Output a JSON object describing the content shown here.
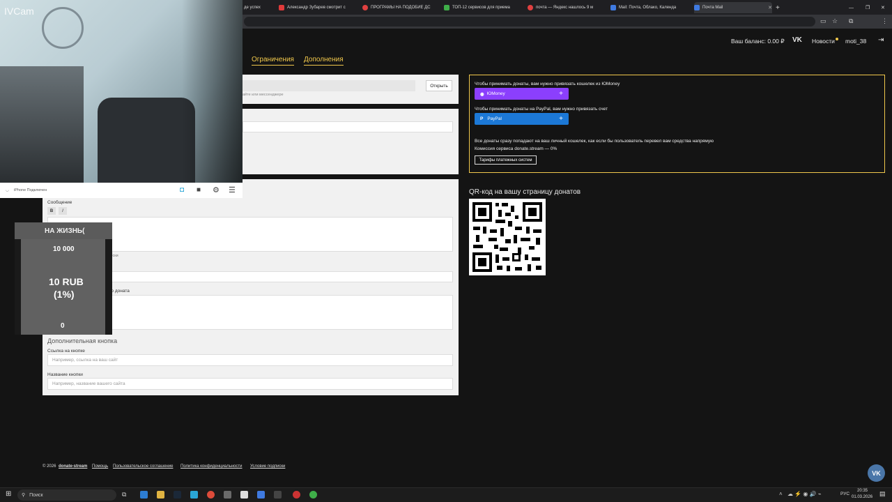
{
  "browser": {
    "tabs": [
      {
        "label": "де успех",
        "fav": "#c33"
      },
      {
        "label": "Александр Зубарев смотрит с",
        "fav": "#e03a3a"
      },
      {
        "label": "ПРОГРАМЫ НА ПОДОБИЕ ДС",
        "fav": "#e04040"
      },
      {
        "label": "ТОП-12 сервисов для приема",
        "fav": "#3fae49"
      },
      {
        "label": "почта — Яндекс нашлось 9 м",
        "fav": "#e04040"
      },
      {
        "label": "Mail: Почта, Облако, Календа",
        "fav": "#3f7ae0"
      },
      {
        "label": "Почта Mail",
        "fav": "#3f7ae0"
      }
    ],
    "new_tab": "+"
  },
  "webcam": {
    "label": "IVCam",
    "phone_label": "iPhone Подключен"
  },
  "header": {
    "balance": "Ваш баланс: 0.00 ₽",
    "vk": "VK",
    "news": "Новости",
    "user": "moti_38",
    "logout_icon": "logout-icon"
  },
  "nav": {
    "restrictions": "Ограничения",
    "additions": "Дополнения"
  },
  "link_panel": {
    "open_button": "Открыть",
    "hint": "айте или мессенджере"
  },
  "form": {
    "message_label": "Сообщение",
    "bold": "B",
    "italic": "I",
    "auto_hint": "тически",
    "donate_label": "ного доната",
    "extra_button_title": "Дополнительная кнопка",
    "button_link_label": "Ссылка на кнопке",
    "button_link_placeholder": "Например, ссылка на ваш сайт",
    "button_name_label": "Название кнопки",
    "button_name_placeholder": "Например, название вашего сайта"
  },
  "payments": {
    "yoomoney_text": "Чтобы принимать донаты, вам нужно привязать кошелек из ЮMoney",
    "yoomoney_button": "ЮMoney",
    "paypal_text": "Чтобы принимать донаты на PayPal, вам нужно привязать счет",
    "paypal_button": "PayPal",
    "info_line": "Все донаты сразу попадают на ваш личный кошелек, как если бы пользователь перевел вам средства напрямую",
    "commission": "Комиссия сервиса donate.stream — 0%",
    "tariffs_button": "Тарифы платежных систем",
    "yoomoney_color": "#8b3ffd",
    "paypal_color": "#1c78d6"
  },
  "qr": {
    "title": "QR-код на вашу страницу донатов"
  },
  "overlay": {
    "title": "НА ЖИЗНЬ(",
    "goal": "10 000",
    "amount": "10 RUB",
    "percent": "(1%)",
    "zero": "0"
  },
  "footer": {
    "copyright": "© 2026",
    "brand": "donate-stream",
    "links": [
      "Помощь",
      "Пользовательское соглашение",
      "Политика конфиденциальности",
      "Условие подписки"
    ]
  },
  "taskbar": {
    "search": "Поиск",
    "lang": "РУС",
    "time": "20:35",
    "date": "01.03.2026"
  }
}
